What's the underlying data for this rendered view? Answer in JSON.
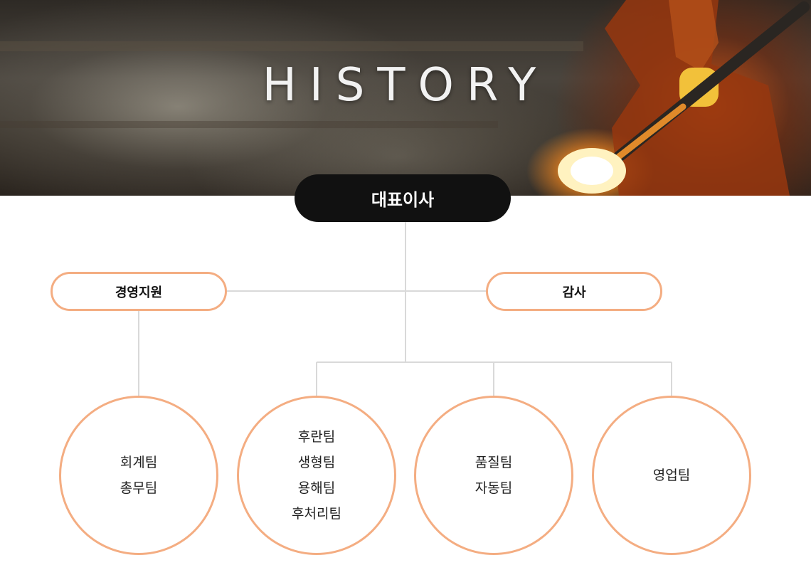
{
  "hero": {
    "title": "HISTORY"
  },
  "org": {
    "ceo": "대표이사",
    "management_support": "경영지원",
    "audit": "감사",
    "teams": [
      {
        "lines": [
          "회계팀",
          "총무팀"
        ]
      },
      {
        "lines": [
          "후란팀",
          "생형팀",
          "용해팀",
          "후처리팀"
        ]
      },
      {
        "lines": [
          "품질팀",
          "자동팀"
        ]
      },
      {
        "lines": [
          "영업팀"
        ]
      }
    ]
  },
  "colors": {
    "accent_border": "#f4ad82",
    "ceo_background": "#111111",
    "connector_line": "#d9d9d9"
  }
}
